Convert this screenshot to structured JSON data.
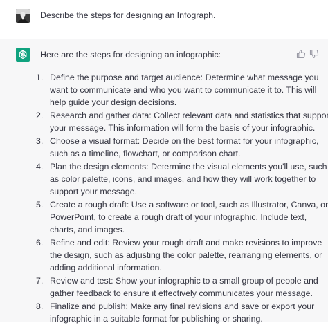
{
  "user_message": {
    "avatar": "user-photo-avatar",
    "text": "Describe the steps for designing an Infograph."
  },
  "assistant_message": {
    "avatar": "openai-logo-icon",
    "avatar_color": "#10a37f",
    "intro": "Here are the steps for designing an infographic:",
    "feedback": {
      "thumbs_up_icon": "thumbs-up-icon",
      "thumbs_down_icon": "thumbs-down-icon"
    },
    "steps": [
      {
        "number": "1.",
        "lines": [
          "Define the purpose and target audience: Determine what message you",
          "want to communicate and who you want to communicate it to. This will",
          "help guide your design decisions."
        ]
      },
      {
        "number": "2.",
        "lines": [
          "Research and gather data: Collect relevant data and statistics that support",
          "your message. This information will form the basis of your infographic."
        ]
      },
      {
        "number": "3.",
        "lines": [
          "Choose a visual format: Decide on the best format for your infographic,",
          "such as a timeline, flowchart, or comparison chart."
        ]
      },
      {
        "number": "4.",
        "lines": [
          "Plan the design elements: Determine the visual elements you'll use, such",
          "as color palette, icons, and images, and how they will work together to",
          "support your message."
        ]
      },
      {
        "number": "5.",
        "lines": [
          "Create a rough draft: Use a software or tool, such as Illustrator, Canva, or",
          "PowerPoint, to create a rough draft of your infographic. Include text,",
          "charts, and images."
        ]
      },
      {
        "number": "6.",
        "lines": [
          "Refine and edit: Review your rough draft and make revisions to improve",
          "the design, such as adjusting the color palette, rearranging elements, or",
          "adding additional information."
        ]
      },
      {
        "number": "7.",
        "lines": [
          "Review and test: Show your infographic to a small group of people and",
          "gather feedback to ensure it effectively communicates your message."
        ]
      },
      {
        "number": "8.",
        "lines": [
          "Finalize and publish: Make any final revisions and save or export your",
          "infographic in a suitable format for publishing or sharing."
        ]
      }
    ]
  }
}
